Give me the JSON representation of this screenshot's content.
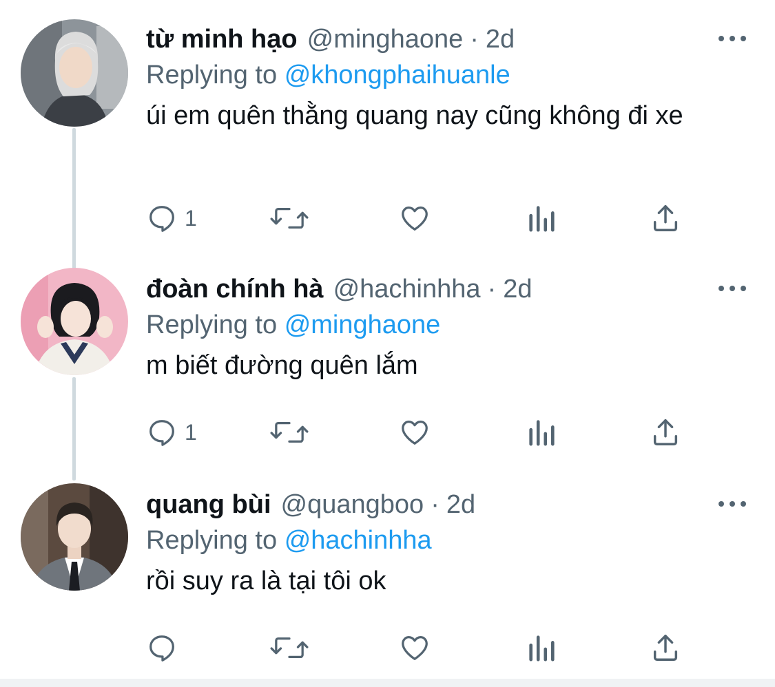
{
  "colors": {
    "accent": "#1d9bf0",
    "secondary_text": "#536471",
    "primary_text": "#0f1419",
    "thread_line": "#cfd9de"
  },
  "icons": [
    "reply-icon",
    "retweet-icon",
    "like-icon",
    "analytics-icon",
    "share-icon",
    "more-icon"
  ],
  "tweets": [
    {
      "name": "từ minh hạo",
      "handle": "@minghaone",
      "separator": "·",
      "time": "2d",
      "replying_label": "Replying to",
      "replying_to": "@khongphaihuanle",
      "text": "úi em quên thằng quang nay cũng không đi xe",
      "reply_count": "1"
    },
    {
      "name": "đoàn chính hà",
      "handle": "@hachinhha",
      "separator": "·",
      "time": "2d",
      "replying_label": "Replying to",
      "replying_to": "@minghaone",
      "text": "m biết đường quên lắm",
      "reply_count": "1"
    },
    {
      "name": "quang bùi",
      "handle": "@quangboo",
      "separator": "·",
      "time": "2d",
      "replying_label": "Replying to",
      "replying_to": "@hachinhha",
      "text": "rồi suy ra là tại tôi ok",
      "reply_count": ""
    }
  ]
}
